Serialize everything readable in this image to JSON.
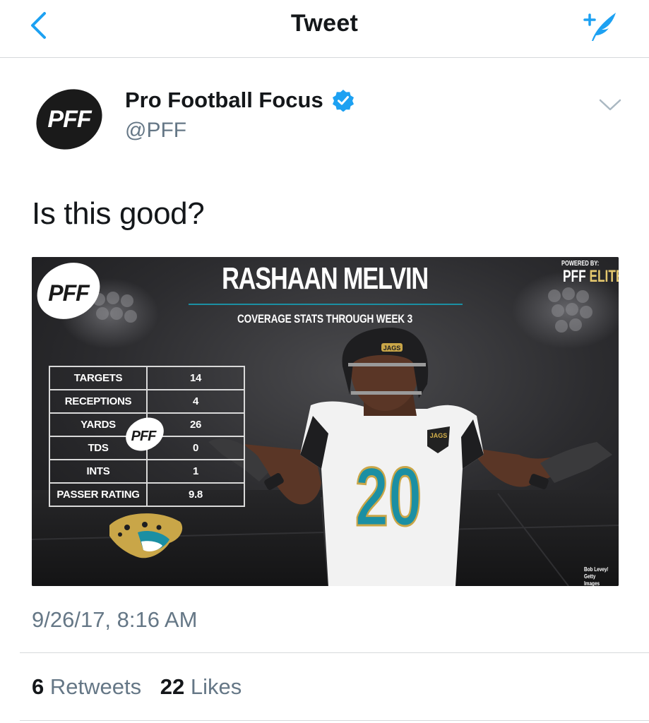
{
  "navbar": {
    "title": "Tweet",
    "back_icon": "chevron-left-icon",
    "compose_icon": "compose-tweet-icon",
    "accent_color": "#1da1f2"
  },
  "author": {
    "name": "Pro Football Focus",
    "handle": "@PFF",
    "verified": true,
    "avatar_text": "PFF",
    "menu_icon": "chevron-down-icon"
  },
  "tweet": {
    "text": "Is this good?",
    "timestamp": "9/26/17, 8:16 AM"
  },
  "media": {
    "title": "RASHAAN MELVIN",
    "subtitle": "COVERAGE STATS THROUGH WEEK 3",
    "powered_by": "POWERED BY:",
    "brand_pff": "PFF",
    "brand_elite": "ELITE",
    "logo_text": "PFF",
    "jersey_number": "20",
    "helmet_text": "JAGS",
    "patch_text": "JAGS",
    "photo_credit_line1": "Bob Levey/",
    "photo_credit_line2": "Getty Images",
    "stats": [
      {
        "label": "TARGETS",
        "value": "14"
      },
      {
        "label": "RECEPTIONS",
        "value": "4"
      },
      {
        "label": "YARDS",
        "value": "26"
      },
      {
        "label": "TDS",
        "value": "0"
      },
      {
        "label": "INTS",
        "value": "1"
      },
      {
        "label": "PASSER RATING",
        "value": "9.8"
      }
    ]
  },
  "engagement": {
    "retweets_count": "6",
    "retweets_label": "Retweets",
    "likes_count": "22",
    "likes_label": "Likes"
  }
}
